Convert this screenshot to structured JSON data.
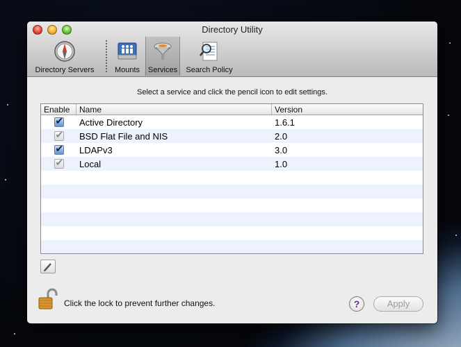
{
  "window": {
    "title": "Directory Utility"
  },
  "toolbar": {
    "items": [
      {
        "label": "Directory Servers",
        "icon": "compass-icon"
      },
      {
        "label": "Mounts",
        "icon": "network-drive-icon"
      },
      {
        "label": "Services",
        "icon": "services-icon",
        "selected": true
      },
      {
        "label": "Search Policy",
        "icon": "search-policy-icon"
      }
    ]
  },
  "instruction": "Select a service and click the pencil icon to edit settings.",
  "table": {
    "headers": {
      "enable": "Enable",
      "name": "Name",
      "version": "Version"
    },
    "rows": [
      {
        "enabled": true,
        "editable": true,
        "name": "Active Directory",
        "version": "1.6.1"
      },
      {
        "enabled": true,
        "editable": false,
        "name": "BSD Flat File and NIS",
        "version": "2.0"
      },
      {
        "enabled": true,
        "editable": true,
        "name": "LDAPv3",
        "version": "3.0"
      },
      {
        "enabled": true,
        "editable": false,
        "name": "Local",
        "version": "1.0"
      }
    ]
  },
  "lock": {
    "text": "Click the lock to prevent further changes."
  },
  "buttons": {
    "help": "?",
    "apply": "Apply"
  },
  "colors": {
    "selection_blue": "#5f93d6",
    "alt_row": "#edf3fe"
  }
}
